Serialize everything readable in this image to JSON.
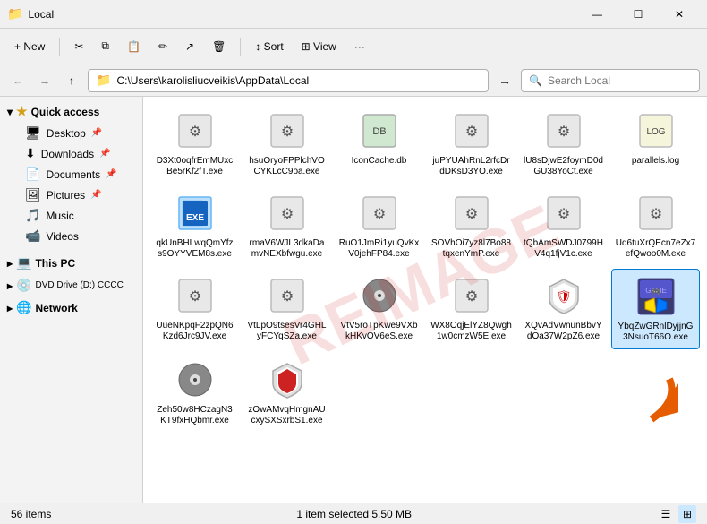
{
  "window": {
    "title": "Local",
    "icon": "📁"
  },
  "titlebar": {
    "title": "Local",
    "minimize_label": "—",
    "maximize_label": "☐",
    "close_label": "✕"
  },
  "toolbar": {
    "new_label": "+ New",
    "cut_icon": "✂",
    "copy_icon": "⧉",
    "paste_icon": "📋",
    "rename_icon": "✏",
    "share_icon": "↗",
    "delete_icon": "🗑",
    "sort_label": "↕ Sort",
    "view_label": "⊞ View",
    "more_label": "···"
  },
  "addressbar": {
    "back_icon": "←",
    "forward_icon": "→",
    "up_icon": "↑",
    "path": "C:\\Users\\karolisliucveikis\\AppData\\Local",
    "search_placeholder": "Search Local",
    "search_icon": "🔍",
    "arrow_icon": "→"
  },
  "sidebar": {
    "quick_access_label": "Quick access",
    "items": [
      {
        "label": "Desktop",
        "icon": "🖥",
        "pinned": true,
        "id": "desktop"
      },
      {
        "label": "Downloads",
        "icon": "⬇",
        "pinned": true,
        "id": "downloads"
      },
      {
        "label": "Documents",
        "icon": "📄",
        "pinned": true,
        "id": "documents"
      },
      {
        "label": "Pictures",
        "icon": "🖼",
        "pinned": true,
        "id": "pictures"
      },
      {
        "label": "Music",
        "icon": "🎵",
        "pinned": false,
        "id": "music"
      },
      {
        "label": "Videos",
        "icon": "📹",
        "pinned": false,
        "id": "videos"
      }
    ],
    "this_pc_label": "This PC",
    "dvd_label": "DVD Drive (D:) CCCC",
    "network_label": "Network"
  },
  "files": [
    {
      "name": "D3Xt0oqfrEmMUxcBe5rKf2fT.exe",
      "icon": "⚙",
      "type": "exe"
    },
    {
      "name": "hsuOryoFPPlchVOCYKLcC9oa.exe",
      "icon": "⚙",
      "type": "exe"
    },
    {
      "name": "IconCache.db",
      "icon": "🗄",
      "type": "db"
    },
    {
      "name": "juPYUAhRnL2rfcDrdDKsD3YO.exe",
      "icon": "⚙",
      "type": "exe"
    },
    {
      "name": "lU8sDjwE2foymD0dGU38YoCt.exe",
      "icon": "⚙",
      "type": "exe"
    },
    {
      "name": "parallels.log",
      "icon": "📝",
      "type": "log"
    },
    {
      "name": "qkUnBHLwqQmYfzs9OYYVEM8s.exe",
      "icon": "📋",
      "type": "exe",
      "color": "#1565c0"
    },
    {
      "name": "rmaV6WJL3dkaDamvNEXbfwgu.exe",
      "icon": "⚙",
      "type": "exe"
    },
    {
      "name": "RuO1JmRi1yuQvKxV0jehFP84.exe",
      "icon": "⚙",
      "type": "exe"
    },
    {
      "name": "SOVhOi7yz8l7Bo88tqxenYmP.exe",
      "icon": "⚙",
      "type": "exe"
    },
    {
      "name": "tQbAmSWDJ0799HV4q1fjV1c.exe",
      "icon": "⚙",
      "type": "exe"
    },
    {
      "name": "Uq6tuXrQEcn7eZx7efQwoo0M.exe",
      "icon": "⚙",
      "type": "exe"
    },
    {
      "name": "UueNKpqF2zpQN6Kzd6Jrc9JV.exe",
      "icon": "⚙",
      "type": "exe"
    },
    {
      "name": "VtLpO9tsesVr4GHLyFCYqSZa.exe",
      "icon": "⚙",
      "type": "exe"
    },
    {
      "name": "VtV5roTpKwe9VXbkHKvOV6eS.exe",
      "icon": "💿",
      "type": "exe"
    },
    {
      "name": "WX8OqjElYZ8Qwgh1w0cmzW5E.exe",
      "icon": "⚙",
      "type": "exe"
    },
    {
      "name": "XQvAdVwnunBbvYdOa37W2pZ6.exe",
      "icon": "🛡",
      "type": "exe"
    },
    {
      "name": "YbqZwGRnlDyjjnG3NsuoT66O.exe",
      "icon": "🎮",
      "type": "exe",
      "selected": true,
      "shield": true
    },
    {
      "name": "Zeh50w8HCzagN3KT9fxHQbmr.exe",
      "icon": "💿",
      "type": "exe"
    },
    {
      "name": "zOwAMvqHmgnAUcxySXSxrbS1.exe",
      "icon": "🛡",
      "type": "exe"
    }
  ],
  "statusbar": {
    "count_text": "56 items",
    "selected_text": "1 item selected  5.50 MB"
  }
}
